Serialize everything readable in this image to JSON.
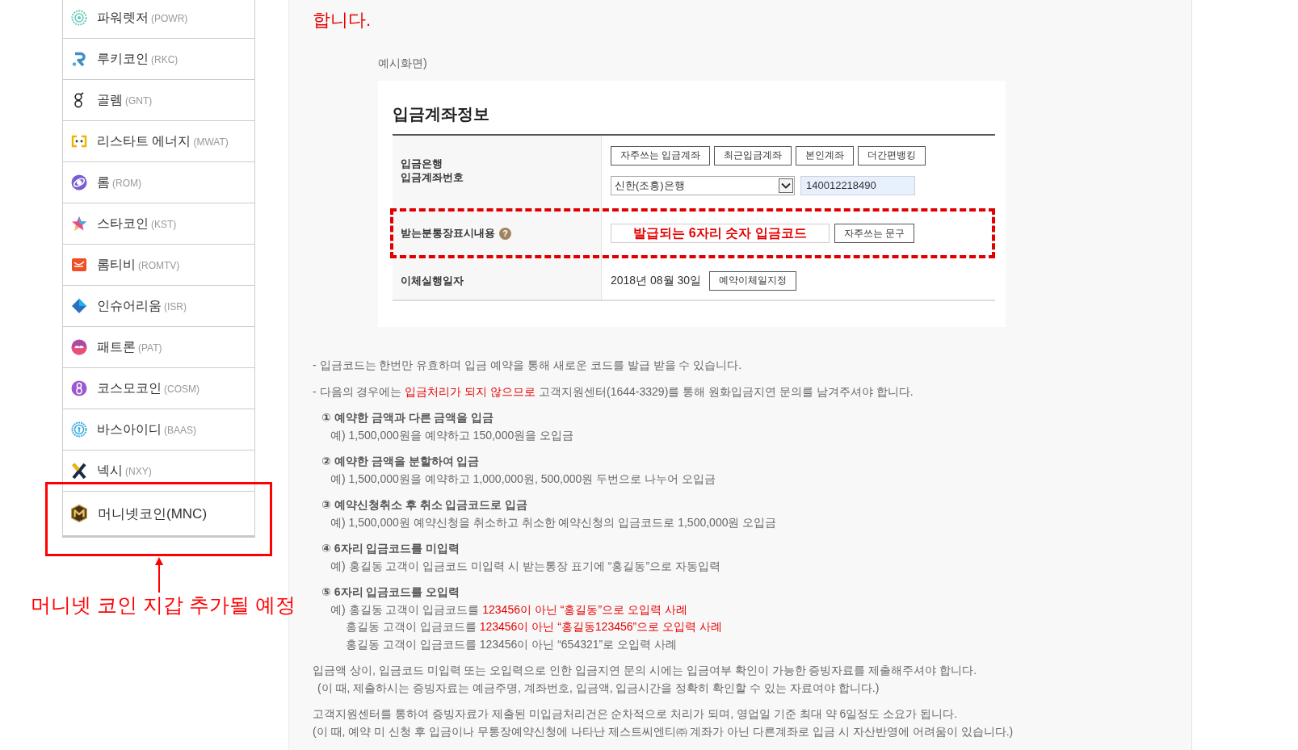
{
  "coin_list": {
    "items": [
      {
        "kind": "coin",
        "name": "파워렛저",
        "ticker": "(POWR)",
        "highlighted": false
      },
      {
        "kind": "coin",
        "name": "루키코인",
        "ticker": "(RKC)",
        "highlighted": false
      },
      {
        "kind": "coin",
        "name": "골렘",
        "ticker": "(GNT)",
        "highlighted": false
      },
      {
        "kind": "coin",
        "name": "리스타트 에너지",
        "ticker": "(MWAT)",
        "highlighted": false
      },
      {
        "kind": "coin",
        "name": "롬",
        "ticker": "(ROM)",
        "highlighted": false
      },
      {
        "kind": "coin",
        "name": "스타코인",
        "ticker": "(KST)",
        "highlighted": false
      },
      {
        "kind": "coin",
        "name": "롬티비",
        "ticker": "(ROMTV)",
        "highlighted": false
      },
      {
        "kind": "coin",
        "name": "인슈어리움",
        "ticker": "(ISR)",
        "highlighted": false
      },
      {
        "kind": "coin",
        "name": "패트론",
        "ticker": "(PAT)",
        "highlighted": false
      },
      {
        "kind": "coin",
        "name": "코스모코인",
        "ticker": "(COSM)",
        "highlighted": false
      },
      {
        "kind": "coin",
        "name": "바스아이디",
        "ticker": "(BAAS)",
        "highlighted": false
      },
      {
        "kind": "coin",
        "name": "넥시",
        "ticker": "(NXY)",
        "highlighted": false
      },
      {
        "kind": "featured",
        "name": "머니넷코인(MNC)",
        "highlighted": true
      }
    ]
  },
  "annotation": {
    "caption": "머니넷 코인 지갑 추가될 예정"
  },
  "notice_tail": {
    "parts": [
      {
        "text": "합니다.",
        "emphasis": true
      }
    ]
  },
  "example_label": "예시화면)",
  "deposit_form": {
    "title": "입금계좌정보",
    "rows": [
      {
        "kind": "account",
        "labels": [
          "입금은행",
          "입금계좌번호"
        ],
        "buttons": [
          "자주쓰는 입금계좌",
          "최근입금계좌",
          "본인계좌",
          "더간편뱅킹"
        ],
        "bank_select": "신한(조흥)은행",
        "account_number": "140012218490",
        "highlighted": false
      },
      {
        "kind": "memo",
        "label": "받는분통장표시내용",
        "help": "?",
        "memo_value": "발급되는 6자리 숫자 입금코드",
        "button": "자주쓰는 문구",
        "highlighted": true
      },
      {
        "kind": "date",
        "label": "이체실행일자",
        "date": "2018년 08월 30일",
        "button": "예약이체일지정",
        "highlighted": false
      }
    ]
  },
  "notes": [
    {
      "parts": [
        {
          "text": "- 입금코드는 한번만 유효하며 입금 예약을 통해 새로운 코드를 발급 받을 수 있습니다.",
          "emphasis": false
        }
      ]
    },
    {
      "parts": [
        {
          "text": "- 다음의 경우에는 ",
          "emphasis": false
        },
        {
          "text": "입금처리가 되지 않으므로",
          "emphasis": true
        },
        {
          "text": " 고객지원센터(1644-3329)를 통해 원화입금지연 문의를 남겨주셔야 합니다.",
          "emphasis": false
        }
      ]
    }
  ],
  "cases": [
    {
      "title": "① 예약한 금액과 다른 금액을 입금",
      "examples": [
        {
          "indented": false,
          "parts": [
            {
              "text": "예) 1,500,000원을 예약하고 150,000원을 오입금",
              "emphasis": false
            }
          ]
        }
      ]
    },
    {
      "title": "② 예약한 금액을 분할하여 입금",
      "examples": [
        {
          "indented": false,
          "parts": [
            {
              "text": "예) 1,500,000원을 예약하고 1,000,000원, 500,000원 두번으로 나누어 오입금",
              "emphasis": false
            }
          ]
        }
      ]
    },
    {
      "title": "③ 예약신청취소 후 취소 입금코드로 입금",
      "examples": [
        {
          "indented": false,
          "parts": [
            {
              "text": "예) 1,500,000원 예약신청을 취소하고 취소한 예약신청의 입금코드로 1,500,000원 오입금",
              "emphasis": false
            }
          ]
        }
      ]
    },
    {
      "title": "④ 6자리 입금코드를 미입력",
      "examples": [
        {
          "indented": false,
          "parts": [
            {
              "text": "예) 홍길동 고객이 입금코드 미입력 시 받는통장 표기에 “홍길동”으로 자동입력",
              "emphasis": false
            }
          ]
        }
      ]
    },
    {
      "title": "⑤ 6자리 입금코드를 오입력",
      "examples": [
        {
          "indented": false,
          "parts": [
            {
              "text": "예) 홍길동 고객이 입금코드를 ",
              "emphasis": false
            },
            {
              "text": "123456이 아닌 “홍길동”으로 오입력 사례",
              "emphasis": true
            }
          ]
        },
        {
          "indented": true,
          "parts": [
            {
              "text": "홍길동 고객이 입금코드를 ",
              "emphasis": false
            },
            {
              "text": "123456이 아닌 “홍길동123456”으로 오입력 사례",
              "emphasis": true
            }
          ]
        },
        {
          "indented": true,
          "parts": [
            {
              "text": "홍길동 고객이 입금코드를 123456이 아닌 “654321”로 오입력 사례",
              "emphasis": false
            }
          ]
        }
      ]
    }
  ],
  "paragraphs": [
    {
      "lines": [
        {
          "indented": false,
          "text": "입금액 상이, 입금코드 미입력 또는 오입력으로 인한 입금지연 문의 시에는 입금여부 확인이 가능한 증빙자료를 제출해주셔야 합니다."
        },
        {
          "indented": true,
          "text": "(이 때, 제출하시는 증빙자료는 예금주명, 계좌번호, 입금액, 입금시간을 정확히 확인할 수 있는 자료여야 합니다.)"
        }
      ]
    },
    {
      "lines": [
        {
          "indented": false,
          "text": "고객지원센터를 통하여 증빙자료가 제출된 미입금처리건은 순차적으로 처리가 되며, 영업일 기준 최대 약 6일정도 소요가 됩니다."
        },
        {
          "indented": false,
          "text": "(이 때, 예약 미 신청 후 입금이나 무통장예약신청에 나타난 제스트씨엔티㈜ 계좌가 아닌 다른계좌로 입금 시 자산반영에 어려움이 있습니다.)"
        }
      ]
    }
  ]
}
